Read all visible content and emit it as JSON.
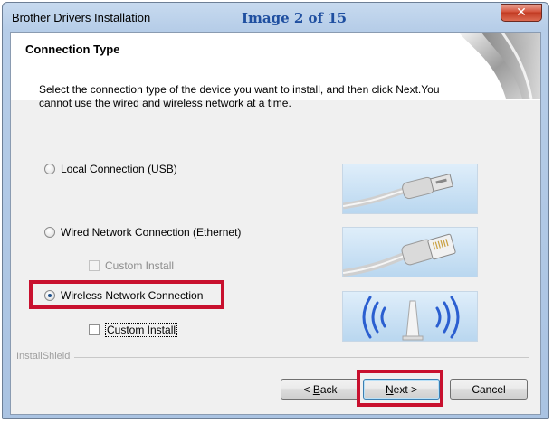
{
  "window": {
    "title": "Brother Drivers Installation",
    "image_caption": "Image 2 of 15",
    "close_glyph": "✕"
  },
  "header": {
    "title": "Connection Type"
  },
  "instructions": {
    "line1": "Select the connection type of the device you want to install, and then click Next.You",
    "line2": "cannot use the wired and wireless network at a time."
  },
  "options": {
    "local": {
      "label": "Local Connection (USB)",
      "selected": false
    },
    "wired": {
      "label": "Wired Network Connection (Ethernet)",
      "selected": false
    },
    "wired_custom": {
      "label": "Custom Install",
      "checked": false,
      "enabled": false
    },
    "wireless": {
      "label": "Wireless Network Connection",
      "selected": true
    },
    "wireless_custom": {
      "label": "Custom Install",
      "checked": false,
      "enabled": true
    }
  },
  "brand": "InstallShield",
  "buttons": {
    "back_prefix": "< ",
    "back_mnemonic": "B",
    "back_rest": "ack",
    "next_mnemonic": "N",
    "next_rest": "ext >",
    "cancel": "Cancel"
  },
  "icons": {
    "close": "close-icon",
    "usb": "usb-cable-icon",
    "ethernet": "ethernet-cable-icon",
    "wireless": "wireless-signal-icon"
  },
  "colors": {
    "highlight": "#c8102e",
    "caption": "#1f4fa0",
    "title_bar": "#b6cde8",
    "close_button": "#c13a22"
  }
}
